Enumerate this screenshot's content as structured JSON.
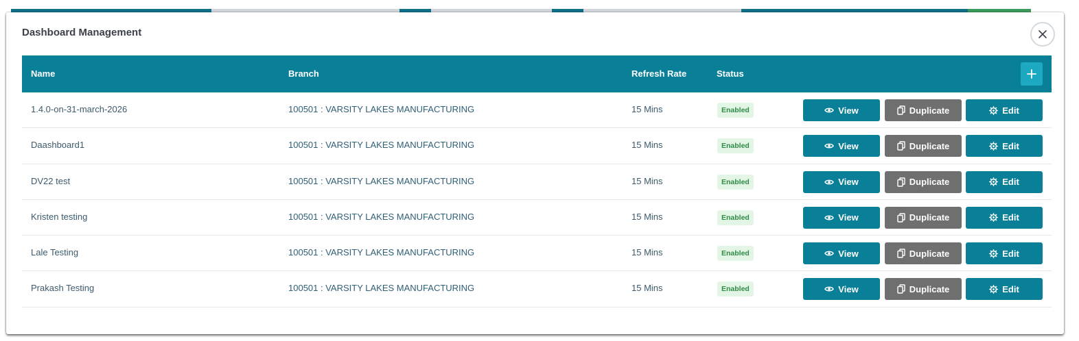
{
  "modal": {
    "title": "Dashboard Management"
  },
  "table": {
    "headers": {
      "name": "Name",
      "branch": "Branch",
      "refresh_rate": "Refresh Rate",
      "status": "Status"
    },
    "rows": [
      {
        "name": "1.4.0-on-31-march-2026",
        "branch": "100501 : VARSITY LAKES MANUFACTURING",
        "refresh_rate": "15 Mins",
        "status": "Enabled"
      },
      {
        "name": "Daashboard1",
        "branch": "100501 : VARSITY LAKES MANUFACTURING",
        "refresh_rate": "15 Mins",
        "status": "Enabled"
      },
      {
        "name": "DV22 test",
        "branch": "100501 : VARSITY LAKES MANUFACTURING",
        "refresh_rate": "15 Mins",
        "status": "Enabled"
      },
      {
        "name": "Kristen testing",
        "branch": "100501 : VARSITY LAKES MANUFACTURING",
        "refresh_rate": "15 Mins",
        "status": "Enabled"
      },
      {
        "name": "Lale Testing",
        "branch": "100501 : VARSITY LAKES MANUFACTURING",
        "refresh_rate": "15 Mins",
        "status": "Enabled"
      },
      {
        "name": "Prakash Testing",
        "branch": "100501 : VARSITY LAKES MANUFACTURING",
        "refresh_rate": "15 Mins",
        "status": "Enabled"
      }
    ]
  },
  "actions": {
    "view_label": "View",
    "duplicate_label": "Duplicate",
    "edit_label": "Edit"
  },
  "icons": {
    "close": "close-icon",
    "add": "plus-icon",
    "view": "eye-icon",
    "duplicate": "copy-icon",
    "edit": "gear-icon"
  },
  "colors": {
    "header_bg": "#0a7f98",
    "add_button": "#1ea9c2",
    "view_button": "#0a7f98",
    "duplicate_button": "#6f6f6f",
    "edit_button": "#0a7f98",
    "badge_bg": "#e3f6e6",
    "badge_text": "#2f8a46"
  }
}
